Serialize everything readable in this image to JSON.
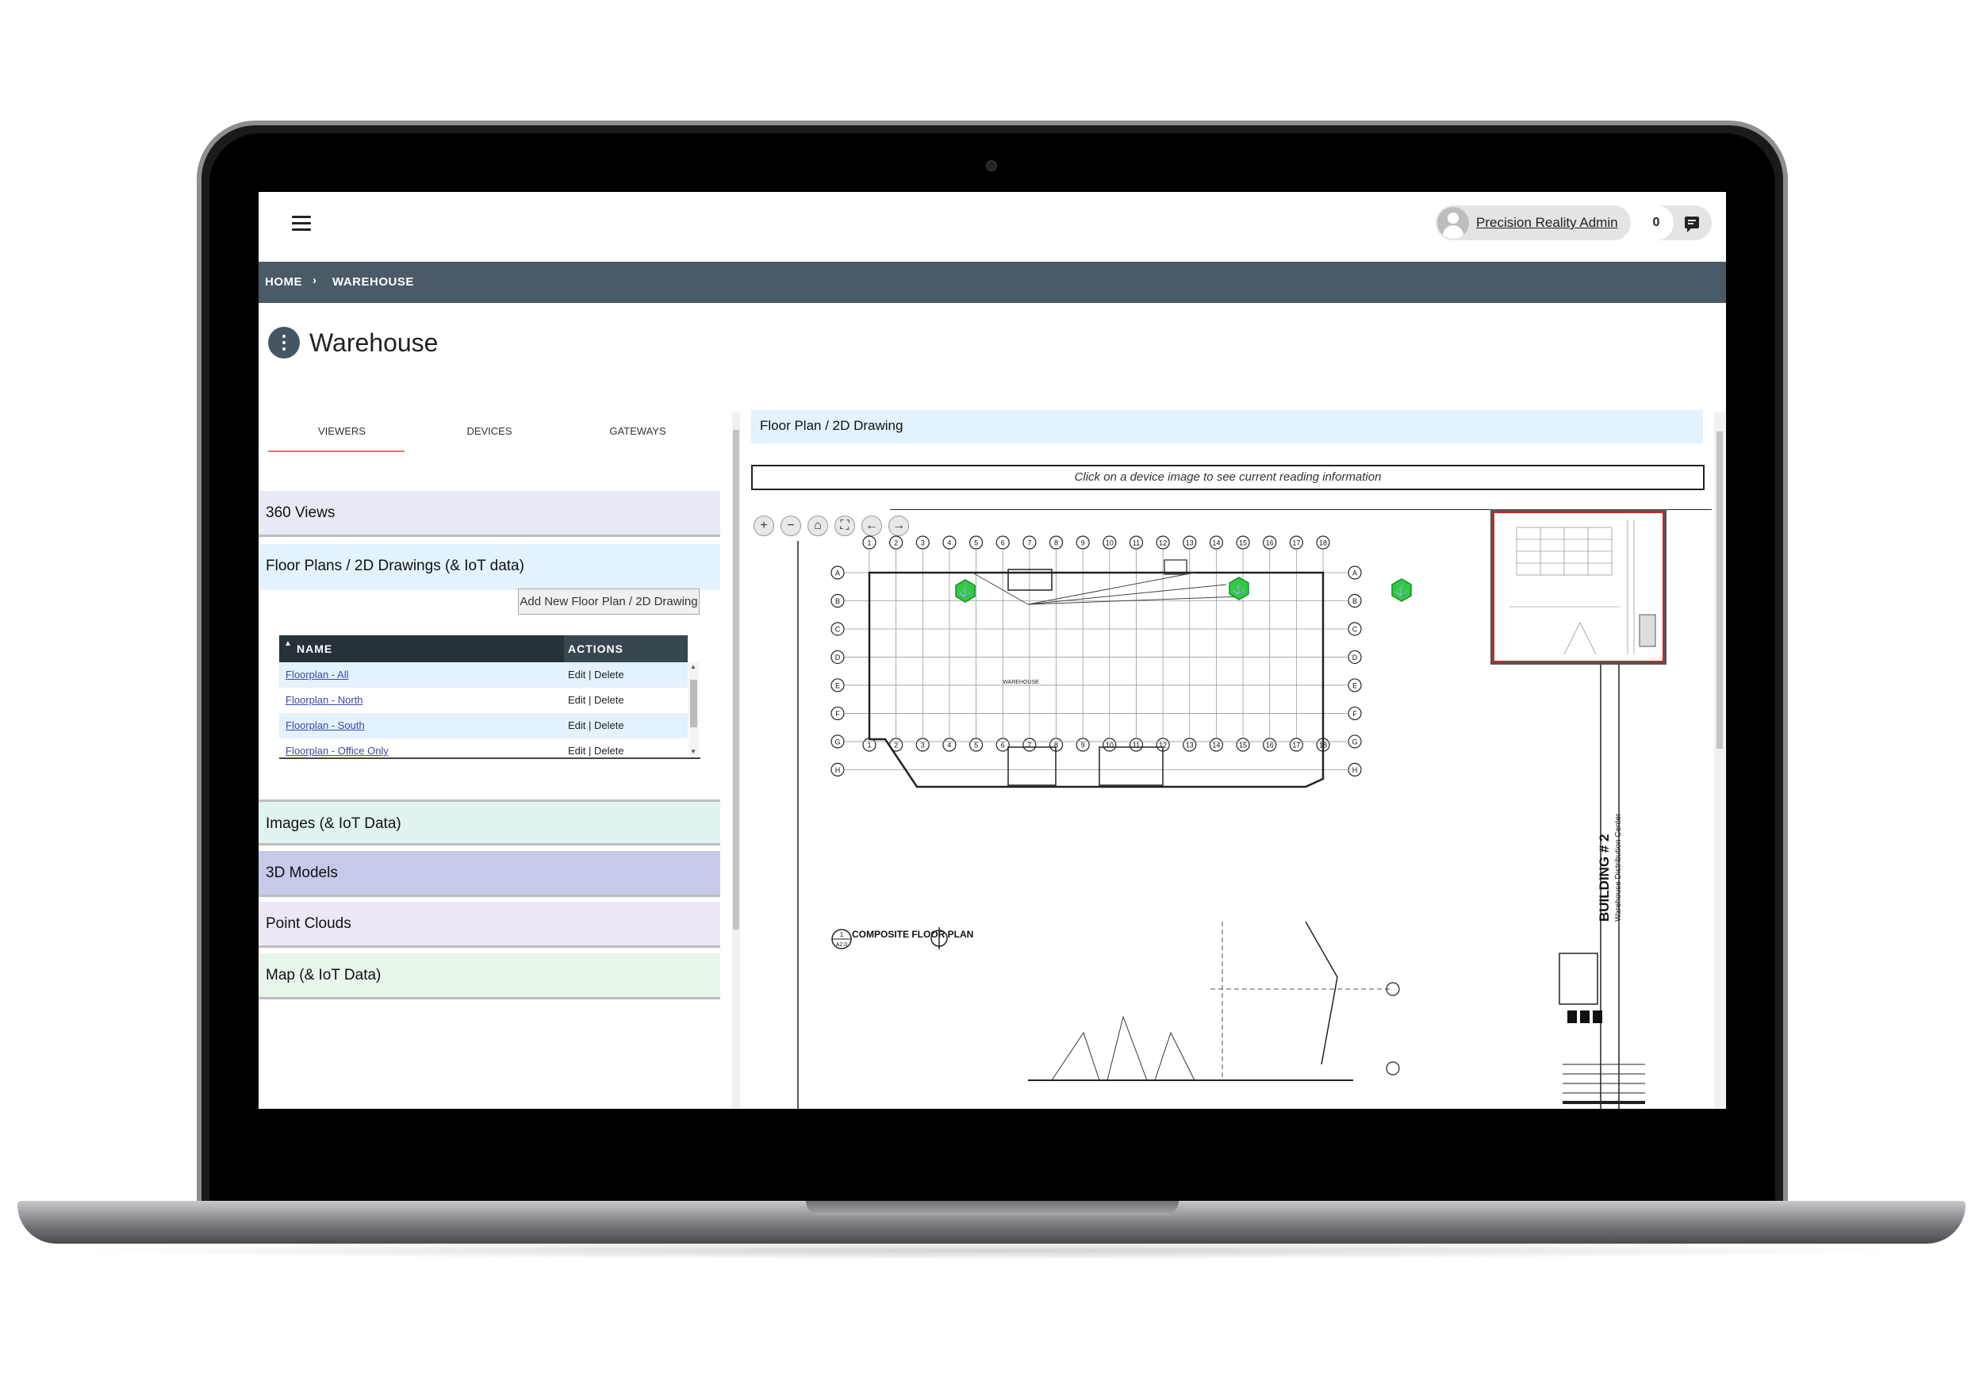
{
  "topbar": {
    "user_name": "Precision Reality Admin",
    "notification_count": "0"
  },
  "breadcrumb": {
    "home": "HOME",
    "separator": "›",
    "current": "WAREHOUSE"
  },
  "page": {
    "title": "Warehouse"
  },
  "tabs": [
    "VIEWERS",
    "DEVICES",
    "GATEWAYS"
  ],
  "sections": {
    "views360": "360 Views",
    "floorplans": "Floor Plans / 2D Drawings (& IoT data)",
    "images": "Images (& IoT Data)",
    "models3d": "3D Models",
    "pointclouds": "Point Clouds",
    "map": "Map (& IoT Data)"
  },
  "add_button": "Add New Floor Plan / 2D Drawing",
  "table": {
    "col_name": "NAME",
    "col_actions": "ACTIONS",
    "edit": "Edit",
    "sep": "|",
    "delete": "Delete",
    "rows": [
      "Floorplan - All",
      "Floorplan - North",
      "Floorplan - South",
      "Floorplan - Office Only"
    ]
  },
  "floorplan": {
    "header": "Floor Plan / 2D Drawing",
    "info": "Click on a device image to see current reading information",
    "zoom_in": "+",
    "zoom_out": "−",
    "drawing_label": "COMPOSITE FLOOR PLAN",
    "drawing_ref_num": "1",
    "drawing_ref_sheet": "A2.0",
    "building_title": "BUILDING # 2",
    "building_subtitle": "Warehouse Distribution Center",
    "room_label": "WAREHOUSE",
    "column_grid": [
      "1",
      "2",
      "3",
      "4",
      "5",
      "6",
      "7",
      "8",
      "9",
      "10",
      "11",
      "12",
      "13",
      "14",
      "15",
      "16",
      "17",
      "18"
    ],
    "row_grid": [
      "A",
      "B",
      "C",
      "D",
      "E",
      "F",
      "G",
      "H"
    ]
  },
  "colors": {
    "breadcrumb_bg": "#4a5a66",
    "iot_marker": "#2ecc40",
    "tab_active_underline": "#e57373"
  }
}
